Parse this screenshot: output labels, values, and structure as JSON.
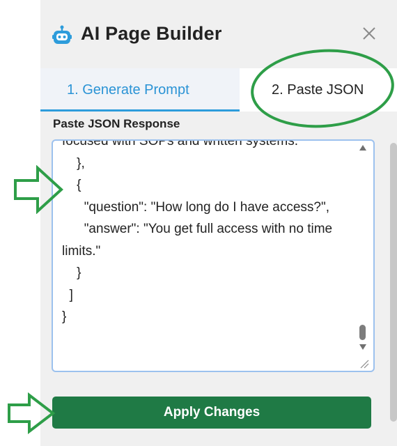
{
  "app": {
    "title": "AI Page Builder",
    "icon": "robot-icon",
    "close_icon": "close-icon"
  },
  "tabs": [
    {
      "label": "1. Generate Prompt",
      "active": false
    },
    {
      "label": "2. Paste JSON",
      "active": true
    }
  ],
  "form": {
    "label": "Paste JSON Response",
    "textarea_value": "focused with SOPs and written systems.\"\n    },\n    {\n      \"question\": \"How long do I have access?\",\n      \"answer\": \"You get full access with no time limits.\"\n    }\n  ]\n}"
  },
  "actions": {
    "apply_label": "Apply Changes"
  },
  "colors": {
    "accent_tab": "#2a93d5",
    "apply_button": "#1f7a45",
    "annotation_green": "#2e9e48"
  }
}
